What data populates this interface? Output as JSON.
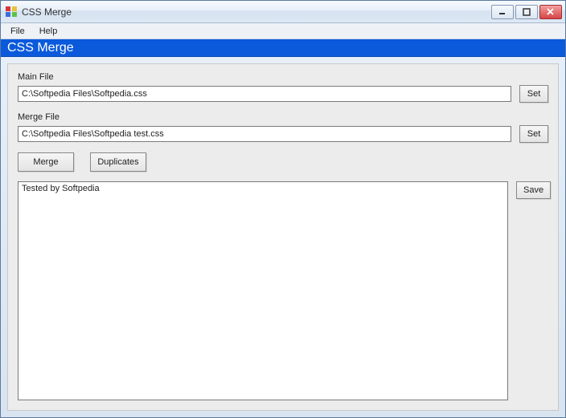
{
  "window": {
    "title": "CSS Merge"
  },
  "menubar": {
    "file": "File",
    "help": "Help"
  },
  "banner": {
    "title": "CSS Merge"
  },
  "mainFile": {
    "label": "Main File",
    "value": "C:\\Softpedia Files\\Softpedia.css",
    "setLabel": "Set"
  },
  "mergeFile": {
    "label": "Merge File",
    "value": "C:\\Softpedia Files\\Softpedia test.css",
    "setLabel": "Set"
  },
  "actions": {
    "merge": "Merge",
    "duplicates": "Duplicates",
    "save": "Save"
  },
  "output": {
    "text": "Tested by Softpedia"
  }
}
